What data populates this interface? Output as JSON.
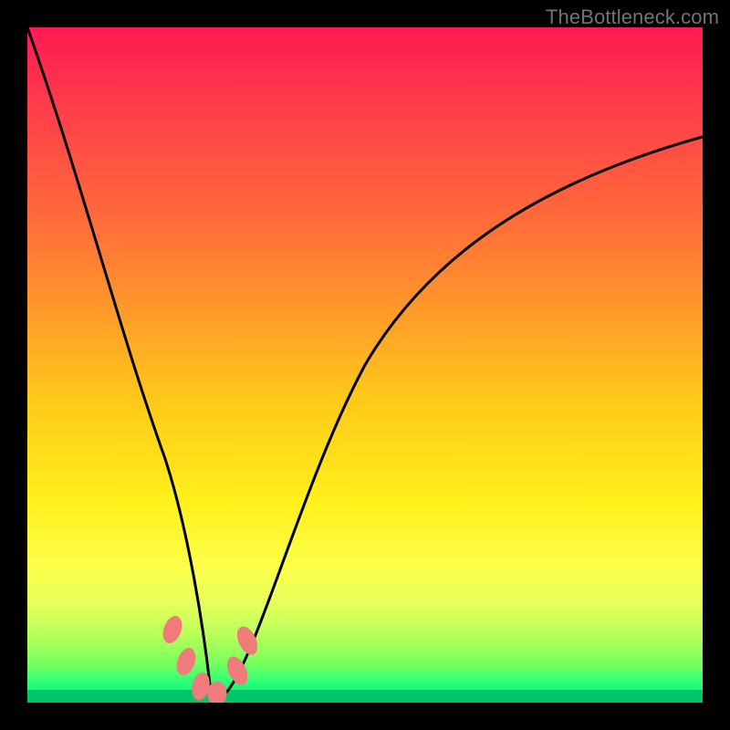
{
  "watermark": {
    "text": "TheBottleneck.com"
  },
  "colors": {
    "frame": "#000000",
    "gradient_top": "#ff1a52",
    "gradient_bottom": "#00e77a",
    "curve": "#000000",
    "markers": "#ef7b7b"
  },
  "chart_data": {
    "type": "line",
    "title": "",
    "xlabel": "",
    "ylabel": "",
    "xlim": [
      0,
      1
    ],
    "ylim": [
      0,
      1
    ],
    "series": [
      {
        "name": "bottleneck-curve",
        "x": [
          0.0,
          0.05,
          0.1,
          0.15,
          0.18,
          0.21,
          0.23,
          0.25,
          0.27,
          0.29,
          0.31,
          0.34,
          0.38,
          0.43,
          0.5,
          0.58,
          0.66,
          0.74,
          0.82,
          0.9,
          1.0
        ],
        "values": [
          1.0,
          0.78,
          0.57,
          0.37,
          0.25,
          0.14,
          0.07,
          0.02,
          0.0,
          0.0,
          0.02,
          0.07,
          0.15,
          0.27,
          0.41,
          0.54,
          0.63,
          0.7,
          0.76,
          0.8,
          0.84
        ]
      }
    ],
    "markers": {
      "name": "optimal-markers",
      "x": [
        0.215,
        0.235,
        0.255,
        0.28,
        0.31,
        0.325
      ],
      "values": [
        0.11,
        0.05,
        0.01,
        0.005,
        0.04,
        0.085
      ]
    }
  }
}
